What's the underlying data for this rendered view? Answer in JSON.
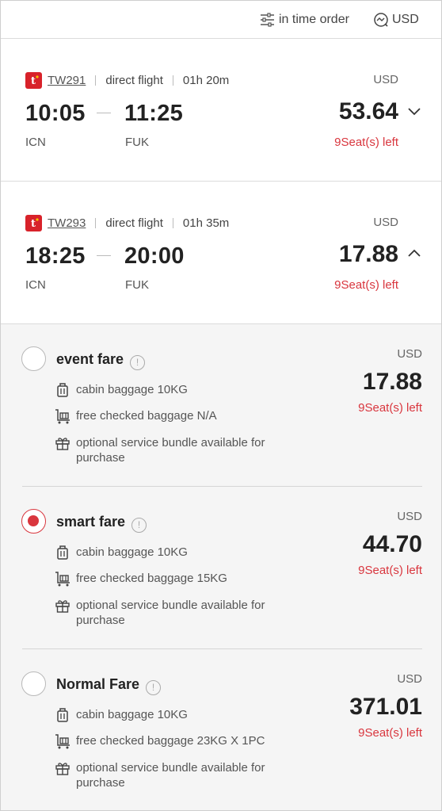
{
  "topbar": {
    "sort_label": "in time order",
    "currency_label": "USD"
  },
  "flights": [
    {
      "flight_no": "TW291",
      "type": "direct flight",
      "duration": "01h 20m",
      "dep_time": "10:05",
      "arr_time": "11:25",
      "dep_airport": "ICN",
      "arr_airport": "FUK",
      "currency": "USD",
      "price": "53.64",
      "seats": "9Seat(s) left",
      "expanded": false
    },
    {
      "flight_no": "TW293",
      "type": "direct flight",
      "duration": "01h 35m",
      "dep_time": "18:25",
      "arr_time": "20:00",
      "dep_airport": "ICN",
      "arr_airport": "FUK",
      "currency": "USD",
      "price": "17.88",
      "seats": "9Seat(s) left",
      "expanded": true
    }
  ],
  "fares": [
    {
      "name": "event fare",
      "selected": false,
      "cabin": "cabin baggage 10KG",
      "checked": "free checked baggage N/A",
      "bundle": "optional service bundle available for purchase",
      "currency": "USD",
      "price": "17.88",
      "seats": "9Seat(s) left"
    },
    {
      "name": "smart fare",
      "selected": true,
      "cabin": "cabin baggage 10KG",
      "checked": "free checked baggage 15KG",
      "bundle": "optional service bundle available for purchase",
      "currency": "USD",
      "price": "44.70",
      "seats": "9Seat(s) left"
    },
    {
      "name": "Normal Fare",
      "selected": false,
      "cabin": "cabin baggage 10KG",
      "checked": "free checked baggage 23KG X 1PC",
      "bundle": "optional service bundle available for purchase",
      "currency": "USD",
      "price": "371.01",
      "seats": "9Seat(s) left"
    }
  ],
  "colors": {
    "accent": "#d9363e",
    "brand": "#d8222a",
    "fare_bg": "#f5f5f5"
  },
  "icons": {
    "sort": "sliders-icon",
    "currency": "currency-exchange-icon",
    "airline": "tway-logo-icon",
    "cabin": "suitcase-icon",
    "checked": "luggage-cart-icon",
    "bundle": "gift-icon",
    "info": "info-icon",
    "expand": "chevron-down-icon",
    "collapse": "chevron-up-icon"
  }
}
